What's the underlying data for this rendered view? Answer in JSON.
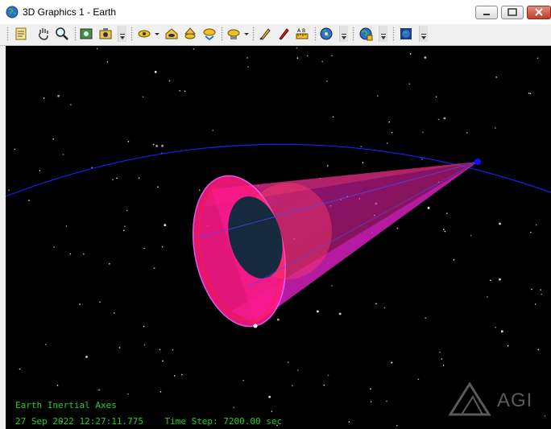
{
  "window": {
    "title": "3D Graphics 1 - Earth",
    "icon": "globe-icon"
  },
  "toolbar": {
    "buttons": [
      {
        "name": "properties-icon"
      },
      {
        "name": "pan-hand-icon"
      },
      {
        "name": "zoom-icon"
      },
      {
        "name": "snapshot-icon"
      },
      {
        "name": "camera-icon"
      },
      {
        "name": "view-from-icon"
      },
      {
        "name": "home-view-icon"
      },
      {
        "name": "view-north-icon"
      },
      {
        "name": "view-top-icon"
      },
      {
        "name": "orient-icon"
      },
      {
        "name": "pen-icon"
      },
      {
        "name": "marker-icon"
      },
      {
        "name": "measure-icon"
      },
      {
        "name": "globe-earth-icon"
      },
      {
        "name": "globe-manager-icon"
      },
      {
        "name": "world-view-icon"
      }
    ]
  },
  "hud": {
    "axes_label": "Earth Inertial Axes",
    "date_time": "27 Sep 2022 12:27:11.775",
    "time_step": "Time Step: 7200.00 sec"
  },
  "logo": {
    "text": "AGI"
  },
  "colors": {
    "background": "#000000",
    "orbit": "#1d1dff",
    "cone_fill": "#ff1a8c",
    "hud_text": "#1fd21f",
    "logo": "#5a5a5a"
  }
}
